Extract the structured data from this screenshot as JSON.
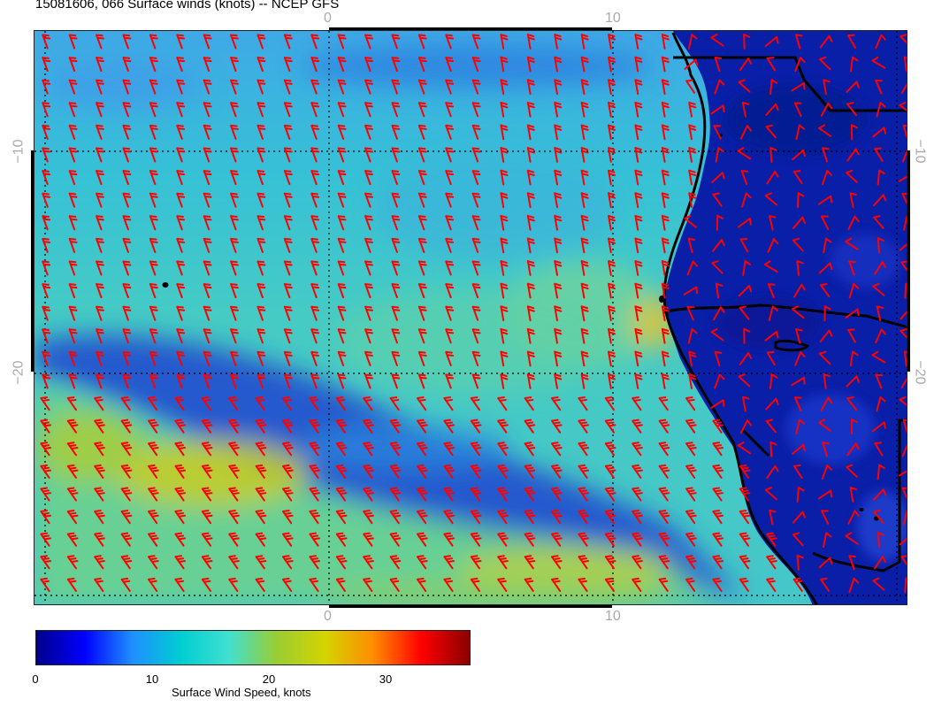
{
  "title": "15081606, 066 Surface winds (knots) -- NCEP GFS",
  "axes": {
    "top_ticks": [
      "0",
      "10"
    ],
    "bottom_ticks": [
      "0",
      "10"
    ],
    "left_ticks": [
      "−10",
      "−20"
    ],
    "right_ticks": [
      "−10",
      "−20"
    ]
  },
  "colorbar": {
    "label": "Surface Wind Speed, knots",
    "ticks": [
      "0",
      "10",
      "20",
      "30"
    ],
    "range": [
      0,
      37
    ],
    "colors": [
      "#00008b",
      "#0000ff",
      "#1e90ff",
      "#00ced1",
      "#40e0d0",
      "#9acd32",
      "#d4d400",
      "#ff8c00",
      "#ff0000",
      "#8b0000"
    ]
  },
  "map": {
    "barb_color": "#ff0000",
    "coastline_color": "#000000",
    "gridline_color": "#000000",
    "ocean_wind_range_knots": [
      8,
      25
    ],
    "land_wind_range_knots": [
      0,
      8
    ]
  }
}
